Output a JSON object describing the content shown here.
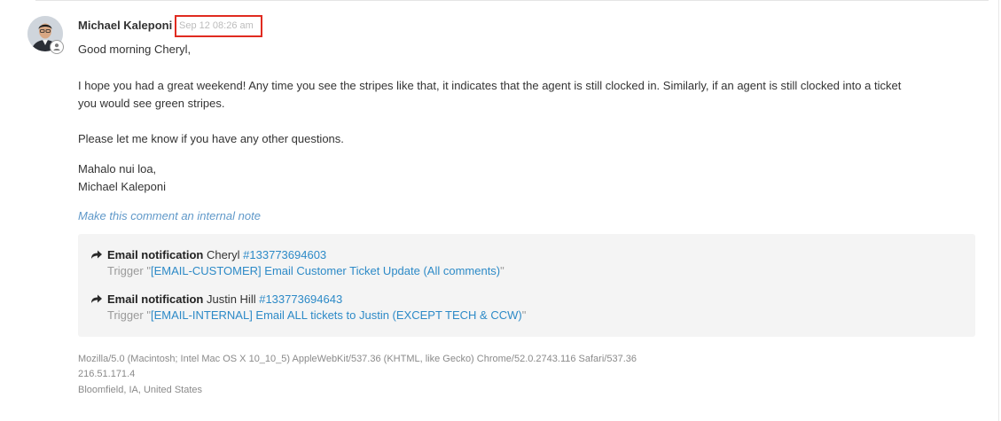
{
  "comment": {
    "author": "Michael Kaleponi",
    "timestamp": "Sep 12 08:26 am",
    "avatar_icon": "user-photo",
    "badge_icon": "person-icon",
    "body": {
      "greeting": "Good morning Cheryl,",
      "paragraph_line1": "I hope you had a great weekend! Any time you see the stripes like that, it indicates that the agent is still clocked in. Similarly, if an agent is still clocked into a ticket",
      "paragraph_line2": "you would see green stripes.",
      "question": "Please let me know if you have any other questions.",
      "signoff": "Mahalo nui loa,",
      "signature": "Michael Kaleponi"
    },
    "internal_note_link": "Make this comment an internal note"
  },
  "events": [
    {
      "icon": "forward-arrow-icon",
      "kind": "Email notification",
      "recipient": "Cheryl",
      "ticket": "#133773694603",
      "trigger_label": "Trigger",
      "trigger_open_quote": "\"",
      "trigger_name": "[EMAIL-CUSTOMER] Email Customer Ticket Update (All comments)",
      "trigger_close_quote": "\""
    },
    {
      "icon": "forward-arrow-icon",
      "kind": "Email notification",
      "recipient": "Justin Hill",
      "ticket": "#133773694643",
      "trigger_label": "Trigger",
      "trigger_open_quote": "\"",
      "trigger_name": "[EMAIL-INTERNAL] Email ALL tickets to Justin (EXCEPT TECH & CCW)",
      "trigger_close_quote": "\""
    }
  ],
  "metadata": {
    "user_agent": "Mozilla/5.0 (Macintosh; Intel Mac OS X 10_10_5) AppleWebKit/537.36 (KHTML, like Gecko) Chrome/52.0.2743.116 Safari/537.36",
    "ip": "216.51.171.4",
    "location": "Bloomfield, IA, United States"
  },
  "colors": {
    "highlight_border": "#e02b20",
    "link": "#2d8ac7",
    "internal_note_link": "#5f98c9",
    "panel_background": "#f4f4f4"
  }
}
